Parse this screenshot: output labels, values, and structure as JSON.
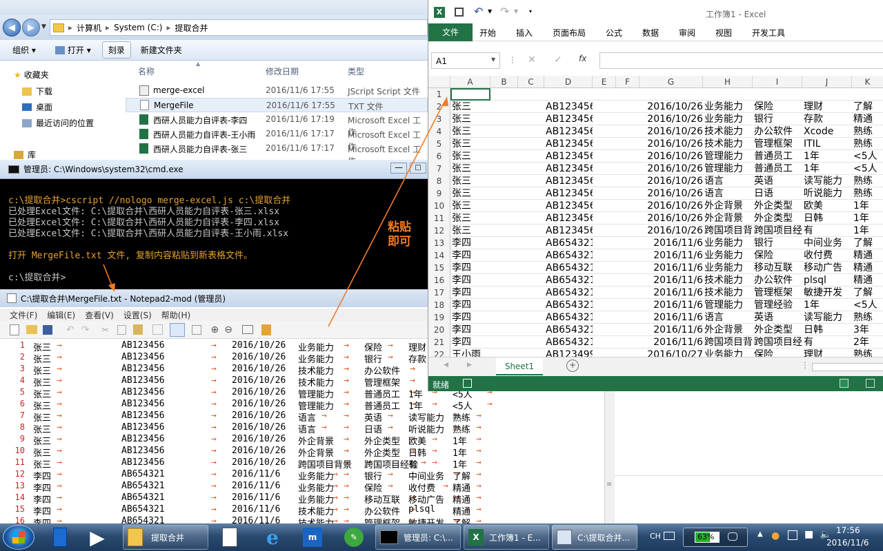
{
  "explorer": {
    "breadcrumb": [
      "计算机",
      "System (C:)",
      "提取合并"
    ],
    "toolbar": {
      "organize": "组织",
      "open": "打开",
      "burn": "刻录",
      "new_folder": "新建文件夹"
    },
    "nav": {
      "favorites": "收藏夹",
      "downloads": "下载",
      "desktop": "桌面",
      "recent": "最近访问的位置",
      "libraries": "库"
    },
    "columns": {
      "name": "名称",
      "modified": "修改日期",
      "type": "类型"
    },
    "files": [
      {
        "name": "merge-excel",
        "modified": "2016/11/6 17:55",
        "type": "JScript Script 文件",
        "icon": "script-icon"
      },
      {
        "name": "MergeFile",
        "modified": "2016/11/6 17:55",
        "type": "TXT 文件",
        "icon": "text-file-icon"
      },
      {
        "name": "西研人员能力自评表-李四",
        "modified": "2016/11/6 17:19",
        "type": "Microsoft Excel 工作",
        "icon": "excel-file-icon"
      },
      {
        "name": "西研人员能力自评表-王小雨",
        "modified": "2016/11/6 17:17",
        "type": "Microsoft Excel 工作",
        "icon": "excel-file-icon"
      },
      {
        "name": "西研人员能力自评表-张三",
        "modified": "2016/11/6 17:17",
        "type": "Microsoft Excel 工作",
        "icon": "excel-file-icon"
      }
    ]
  },
  "cmd": {
    "title": "管理员: C:\\Windows\\system32\\cmd.exe",
    "lines": [
      "c:\\提取合并>cscript //nologo merge-excel.js c:\\提取合并",
      "已处理Excel文件: C:\\提取合并\\西研人员能力自评表-张三.xlsx",
      "已处理Excel文件: C:\\提取合并\\西研人员能力自评表-李四.xlsx",
      "已处理Excel文件: C:\\提取合并\\西研人员能力自评表-王小雨.xlsx",
      "打开 MergeFile.txt 文件, 复制内容粘贴到新表格文件。",
      "c:\\提取合并>"
    ],
    "highlight_color": "#e8a232"
  },
  "annotation": {
    "paste_hint": "粘贴\n即可",
    "color": "#f07c28"
  },
  "notepad": {
    "title": "C:\\提取合并\\MergeFile.txt - Notepad2-mod (管理员)",
    "menu": [
      "文件(F)",
      "编辑(E)",
      "查看(V)",
      "设置(S)",
      "帮助(H)"
    ],
    "lines": [
      [
        "张三",
        "AB123456",
        "2016/10/26",
        "业务能力",
        "保险",
        "理财",
        ""
      ],
      [
        "张三",
        "AB123456",
        "2016/10/26",
        "业务能力",
        "银行",
        "存款",
        ""
      ],
      [
        "张三",
        "AB123456",
        "2016/10/26",
        "技术能力",
        "办公软件",
        "",
        ""
      ],
      [
        "张三",
        "AB123456",
        "2016/10/26",
        "技术能力",
        "管理框架",
        "",
        ""
      ],
      [
        "张三",
        "AB123456",
        "2016/10/26",
        "管理能力",
        "普通员工",
        "1年",
        "<5人"
      ],
      [
        "张三",
        "AB123456",
        "2016/10/26",
        "管理能力",
        "普通员工",
        "1年",
        "<5人"
      ],
      [
        "张三",
        "AB123456",
        "2016/10/26",
        "语言",
        "英语",
        "读写能力",
        "熟练"
      ],
      [
        "张三",
        "AB123456",
        "2016/10/26",
        "语言",
        "日语",
        "听说能力",
        "熟练"
      ],
      [
        "张三",
        "AB123456",
        "2016/10/26",
        "外企背景",
        "外企类型",
        "欧美",
        "1年"
      ],
      [
        "张三",
        "AB123456",
        "2016/10/26",
        "外企背景",
        "外企类型",
        "日韩",
        "1年"
      ],
      [
        "张三",
        "AB123456",
        "2016/10/26",
        "跨国项目背景",
        "跨国项目经验",
        "有",
        "1年"
      ],
      [
        "李四",
        "AB654321",
        "2016/11/6",
        "业务能力",
        "银行",
        "中间业务",
        "了解"
      ],
      [
        "李四",
        "AB654321",
        "2016/11/6",
        "业务能力",
        "保险",
        "收付费",
        "精通"
      ],
      [
        "李四",
        "AB654321",
        "2016/11/6",
        "业务能力",
        "移动互联",
        "移动广告",
        "精通"
      ],
      [
        "李四",
        "AB654321",
        "2016/11/6",
        "技术能力",
        "办公软件",
        "plsql",
        "精通"
      ],
      [
        "李四",
        "AB654321",
        "2016/11/6",
        "技术能力",
        "管理框架",
        "敏捷开发",
        "了解"
      ]
    ]
  },
  "excel": {
    "title": "工作簿1 - Excel",
    "tabs": [
      "文件",
      "开始",
      "插入",
      "页面布局",
      "公式",
      "数据",
      "审阅",
      "视图",
      "开发工具"
    ],
    "name_box": "A1",
    "fx": "fx",
    "columns": [
      "A",
      "B",
      "C",
      "D",
      "E",
      "F",
      "G",
      "H",
      "I",
      "J",
      "K"
    ],
    "rows": [
      [
        "1",
        "",
        "",
        "",
        "",
        "",
        ""
      ],
      [
        "2",
        "张三",
        "AB123456",
        "2016/10/26",
        "业务能力",
        "保险",
        "理财",
        "了解"
      ],
      [
        "3",
        "张三",
        "AB123456",
        "2016/10/26",
        "业务能力",
        "银行",
        "存款",
        "精通"
      ],
      [
        "4",
        "张三",
        "AB123456",
        "2016/10/26",
        "技术能力",
        "办公软件",
        "Xcode",
        "熟练"
      ],
      [
        "5",
        "张三",
        "AB123456",
        "2016/10/26",
        "技术能力",
        "管理框架",
        "ITIL",
        "熟练"
      ],
      [
        "6",
        "张三",
        "AB123456",
        "2016/10/26",
        "管理能力",
        "普通员工",
        "1年",
        "<5人"
      ],
      [
        "7",
        "张三",
        "AB123456",
        "2016/10/26",
        "管理能力",
        "普通员工",
        "1年",
        "<5人"
      ],
      [
        "8",
        "张三",
        "AB123456",
        "2016/10/26",
        "语言",
        "英语",
        "读写能力",
        "熟练"
      ],
      [
        "9",
        "张三",
        "AB123456",
        "2016/10/26",
        "语言",
        "日语",
        "听说能力",
        "熟练"
      ],
      [
        "10",
        "张三",
        "AB123456",
        "2016/10/26",
        "外企背景",
        "外企类型",
        "欧美",
        "1年"
      ],
      [
        "11",
        "张三",
        "AB123456",
        "2016/10/26",
        "外企背景",
        "外企类型",
        "日韩",
        "1年"
      ],
      [
        "12",
        "张三",
        "AB123456",
        "2016/10/26",
        "跨国项目背",
        "跨国项目经",
        "有",
        "1年"
      ],
      [
        "13",
        "李四",
        "AB654321",
        "2016/11/6",
        "业务能力",
        "银行",
        "中间业务",
        "了解"
      ],
      [
        "14",
        "李四",
        "AB654321",
        "2016/11/6",
        "业务能力",
        "保险",
        "收付费",
        "精通"
      ],
      [
        "15",
        "李四",
        "AB654321",
        "2016/11/6",
        "业务能力",
        "移动互联",
        "移动广告",
        "精通"
      ],
      [
        "16",
        "李四",
        "AB654321",
        "2016/11/6",
        "技术能力",
        "办公软件",
        "plsql",
        "精通"
      ],
      [
        "17",
        "李四",
        "AB654321",
        "2016/11/6",
        "技术能力",
        "管理框架",
        "敏捷开发",
        "了解"
      ],
      [
        "18",
        "李四",
        "AB654321",
        "2016/11/6",
        "管理能力",
        "管理经验",
        "1年",
        "<5人"
      ],
      [
        "19",
        "李四",
        "AB654321",
        "2016/11/6",
        "语言",
        "英语",
        "读写能力",
        "熟练"
      ],
      [
        "20",
        "李四",
        "AB654321",
        "2016/11/6",
        "外企背景",
        "外企类型",
        "日韩",
        "3年"
      ],
      [
        "21",
        "李四",
        "AB654321",
        "2016/11/6",
        "跨国项目背",
        "跨国项目经",
        "有",
        "2年"
      ],
      [
        "22",
        "王小雨",
        "AB123499",
        "2016/10/27",
        "业务能力",
        "保险",
        "理财",
        "熟练"
      ]
    ],
    "sheet_tab": "Sheet1",
    "status": "就绪",
    "accent": "#217346"
  },
  "taskbar": {
    "apps": [
      {
        "label": "提取合并",
        "icon": "folder-icon"
      },
      {
        "label": "管理员: C:\\...",
        "icon": "cmd-icon"
      },
      {
        "label": "工作簿1 - E...",
        "icon": "excel-icon"
      },
      {
        "label": "C:\\提取合并...",
        "icon": "notepad-icon"
      }
    ],
    "ime": "CH",
    "battery": "63%",
    "time": "17:56",
    "date": "2016/11/6"
  }
}
